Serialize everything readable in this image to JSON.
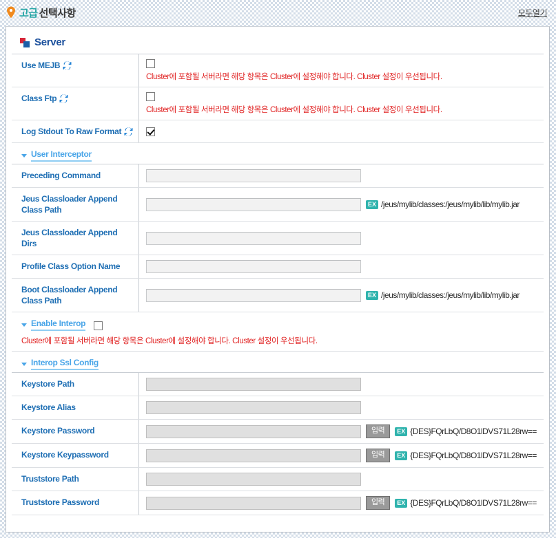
{
  "header": {
    "icon": "pin-marker-icon",
    "title_accent": "고급",
    "title_main": "선택사항",
    "open_all_label": "모두열기"
  },
  "colors": {
    "accent_teal": "#26a6a6",
    "label_blue": "#1f6fb4",
    "section_blue": "#1a4f9c",
    "subsection_blue": "#49a5e8",
    "warning_red": "#e02020",
    "ex_badge": "#2fb3ad"
  },
  "section": {
    "title": "Server",
    "icon": "two-squares-icon"
  },
  "common": {
    "cluster_warning": "Cluster에 포함될 서버라면 해당 항목은 Cluster에 설정해야 합니다. Cluster 설정이 우선됩니다.",
    "ex_badge_label": "EX",
    "classpath_example": "/jeus/mylib/classes:/jeus/mylib/lib/mylib.jar",
    "password_example": "{DES}FQrLbQ/D8O1lDVS71L28rw==",
    "input_button_label": "입력",
    "refresh_icon": "refresh-sync-icon"
  },
  "server_rows": [
    {
      "label": "Use MEJB",
      "has_refresh": true,
      "checked": false,
      "warning": "Cluster에 포함될 서버라면 해당 항목은 Cluster에 설정해야 합니다. Cluster 설정이 우선됩니다."
    },
    {
      "label": "Class Ftp",
      "has_refresh": true,
      "checked": false,
      "warning": "Cluster에 포함될 서버라면 해당 항목은 Cluster에 설정해야 합니다. Cluster 설정이 우선됩니다."
    },
    {
      "label": "Log Stdout To Raw Format",
      "has_refresh": true,
      "checked": true,
      "warning": ""
    }
  ],
  "user_interceptor": {
    "title": "User Interceptor",
    "rows": [
      {
        "label": "Preceding Command",
        "value": "",
        "disabled": false,
        "example": ""
      },
      {
        "label": "Jeus Classloader Append Class Path",
        "value": "",
        "disabled": false,
        "example": "/jeus/mylib/classes:/jeus/mylib/lib/mylib.jar"
      },
      {
        "label": "Jeus Classloader Append Dirs",
        "value": "",
        "disabled": false,
        "example": ""
      },
      {
        "label": "Profile Class Option Name",
        "value": "",
        "disabled": false,
        "example": ""
      },
      {
        "label": "Boot Classloader Append Class Path",
        "value": "",
        "disabled": false,
        "example": "/jeus/mylib/classes:/jeus/mylib/lib/mylib.jar"
      }
    ]
  },
  "enable_interop": {
    "title": "Enable Interop",
    "checked": false,
    "warning": "Cluster에 포함될 서버라면 해당 항목은 Cluster에 설정해야 합니다. Cluster 설정이 우선됩니다."
  },
  "interop_ssl_config": {
    "title": "Interop Ssl Config",
    "rows": [
      {
        "label": "Keystore Path",
        "value": "",
        "disabled": true,
        "has_button": false,
        "example": ""
      },
      {
        "label": "Keystore Alias",
        "value": "",
        "disabled": true,
        "has_button": false,
        "example": ""
      },
      {
        "label": "Keystore Password",
        "value": "",
        "disabled": true,
        "has_button": true,
        "example": "{DES}FQrLbQ/D8O1lDVS71L28rw=="
      },
      {
        "label": "Keystore Keypassword",
        "value": "",
        "disabled": true,
        "has_button": true,
        "example": "{DES}FQrLbQ/D8O1lDVS71L28rw=="
      },
      {
        "label": "Truststore Path",
        "value": "",
        "disabled": true,
        "has_button": false,
        "example": ""
      },
      {
        "label": "Truststore Password",
        "value": "",
        "disabled": true,
        "has_button": true,
        "example": "{DES}FQrLbQ/D8O1lDVS71L28rw=="
      }
    ]
  }
}
